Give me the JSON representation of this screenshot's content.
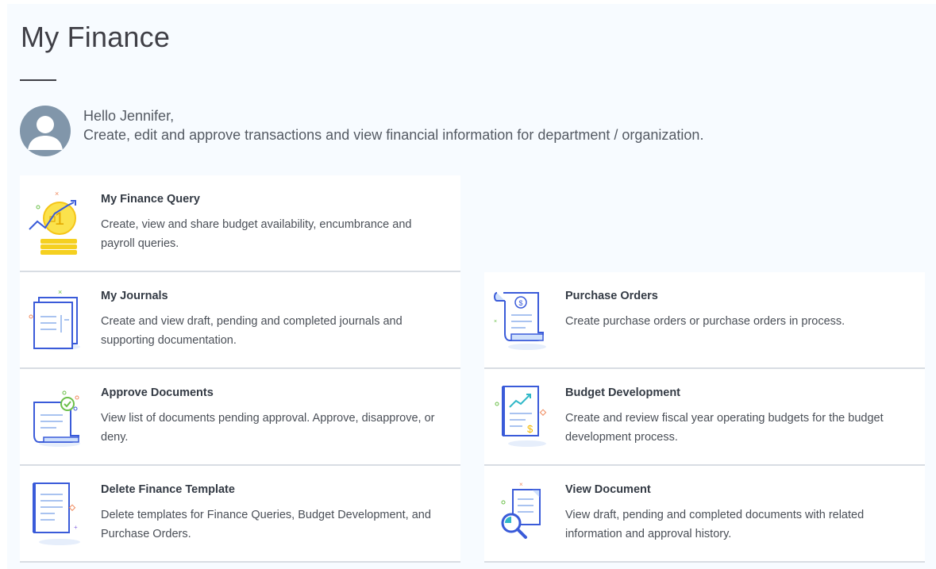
{
  "page": {
    "title": "My Finance",
    "greeting": "Hello Jennifer,",
    "subtitle": "Create, edit and approve transactions and view financial information for department / organization."
  },
  "cards": [
    {
      "icon": "coins-chart-icon",
      "title": "My Finance Query",
      "description": "Create, view and share budget availability, encumbrance and payroll queries."
    },
    {
      "icon": "journals-icon",
      "title": "My Journals",
      "description": "Create and view draft, pending and completed journals and supporting documentation."
    },
    {
      "icon": "approve-document-icon",
      "title": "Approve Documents",
      "description": "View list of documents pending approval. Approve, disapprove, or deny."
    },
    {
      "icon": "delete-template-icon",
      "title": "Delete Finance Template",
      "description": "Delete templates for Finance Queries, Budget Development, and Purchase Orders."
    },
    {
      "icon": "purchase-order-icon",
      "title": "Purchase Orders",
      "description": "Create purchase orders or purchase orders in process."
    },
    {
      "icon": "budget-development-icon",
      "title": "Budget Development",
      "description": "Create and review fiscal year operating budgets for the budget development process."
    },
    {
      "icon": "view-document-icon",
      "title": "View Document",
      "description": "View draft, pending and completed documents with related information and approval history."
    }
  ],
  "colors": {
    "accent_blue": "#3a5bd9",
    "coin_yellow": "#f5d020",
    "avatar": "#8196aa"
  }
}
